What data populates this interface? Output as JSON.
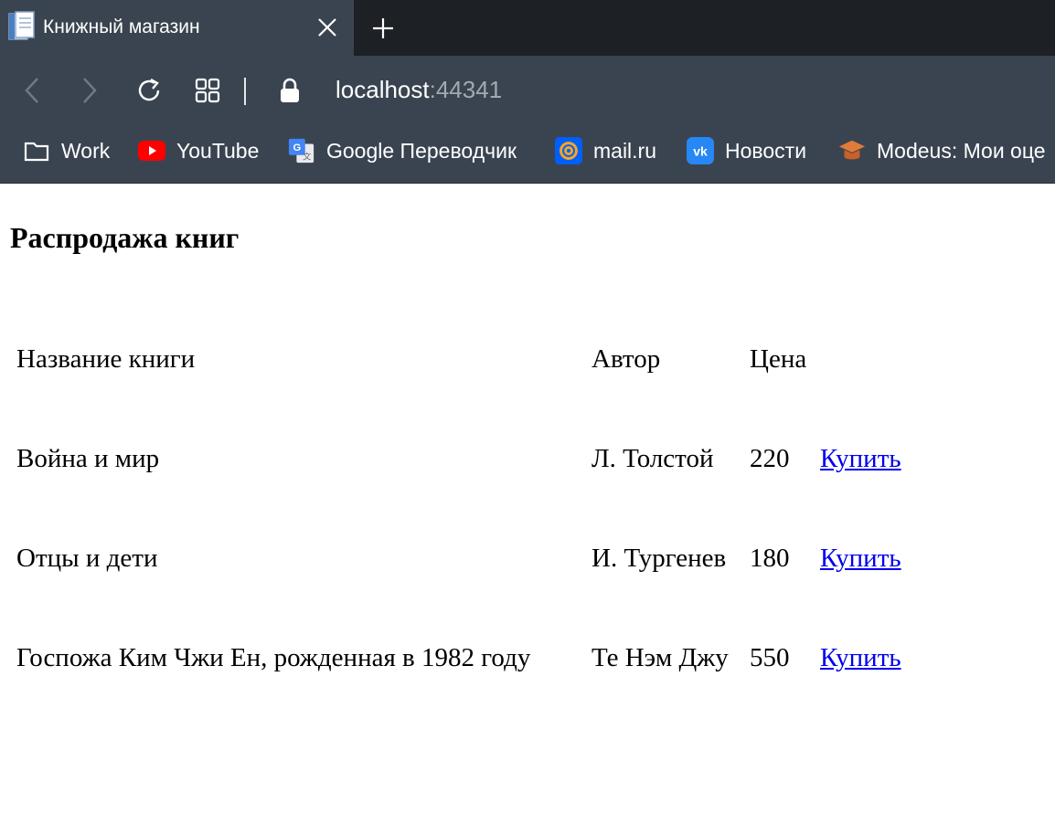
{
  "browser": {
    "tab_title": "Книжный магазин",
    "url_host": "localhost",
    "url_port": ":44341",
    "bookmarks": [
      {
        "label": "Work",
        "icon": "folder-icon"
      },
      {
        "label": "YouTube",
        "icon": "youtube-icon"
      },
      {
        "label": "Google Переводчик",
        "icon": "google-translate-icon"
      },
      {
        "label": "mail.ru",
        "icon": "mailru-icon"
      },
      {
        "label": "Новости",
        "icon": "vk-icon"
      },
      {
        "label": "Modeus: Мои оце",
        "icon": "graduation-cap-icon"
      }
    ],
    "colors": {
      "tab_strip": "#1d2024",
      "toolbar": "#3a4450",
      "youtube_red": "#ff0000",
      "mailru_orange": "#f5a623",
      "vk_blue": "#2787f5",
      "modeus_orange": "#e07b39"
    }
  },
  "page": {
    "heading": "Распродажа книг",
    "table": {
      "headers": [
        "Название книги",
        "Автор",
        "Цена"
      ],
      "rows": [
        {
          "title": "Война и мир",
          "author": "Л. Толстой",
          "price": "220",
          "action": "Купить"
        },
        {
          "title": "Отцы и дети",
          "author": "И. Тургенев",
          "price": "180",
          "action": "Купить"
        },
        {
          "title": "Госпожа Ким Чжи Ен, рожденная в 1982 году",
          "author": "Те Нэм Джу",
          "price": "550",
          "action": "Купить"
        }
      ]
    },
    "link_color": "#0000ee"
  }
}
